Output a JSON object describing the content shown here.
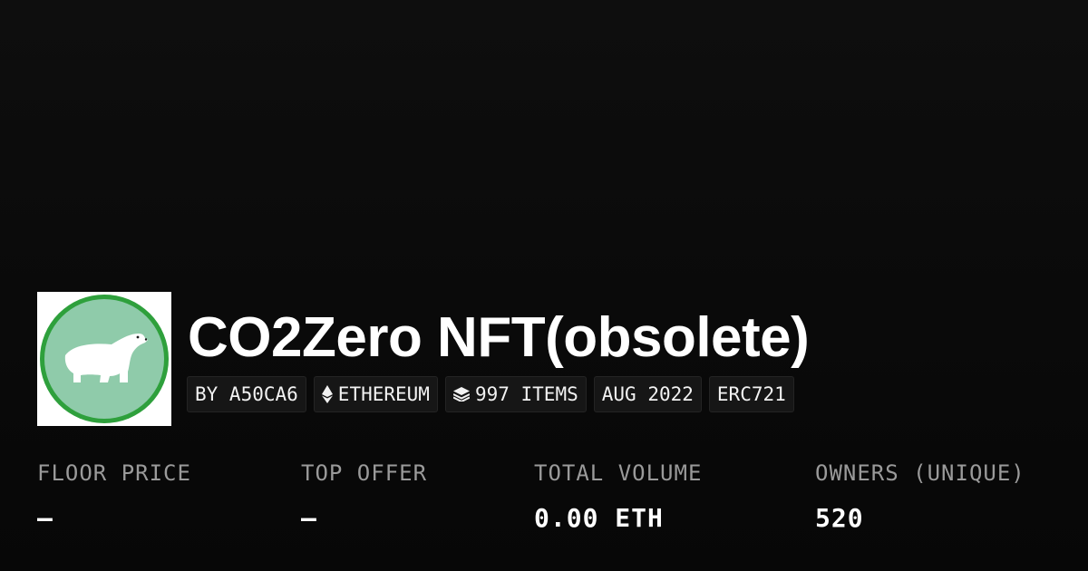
{
  "collection": {
    "title": "CO2Zero NFT(obsolete)",
    "avatar_icon": "polar-bear-logo",
    "avatar_colors": {
      "ring": "#2ea03c",
      "fill": "#8fcbaa",
      "bear": "#ffffff"
    }
  },
  "tags": {
    "creator": "BY A50CA6",
    "chain": "ETHEREUM",
    "chain_icon": "ethereum-icon",
    "items": "997 ITEMS",
    "items_icon": "layers-icon",
    "date": "AUG 2022",
    "standard": "ERC721"
  },
  "stats": [
    {
      "label": "FLOOR PRICE",
      "value": "—"
    },
    {
      "label": "TOP OFFER",
      "value": "—"
    },
    {
      "label": "TOTAL VOLUME",
      "value": "0.00 ETH"
    },
    {
      "label": "OWNERS (UNIQUE)",
      "value": "520"
    }
  ]
}
